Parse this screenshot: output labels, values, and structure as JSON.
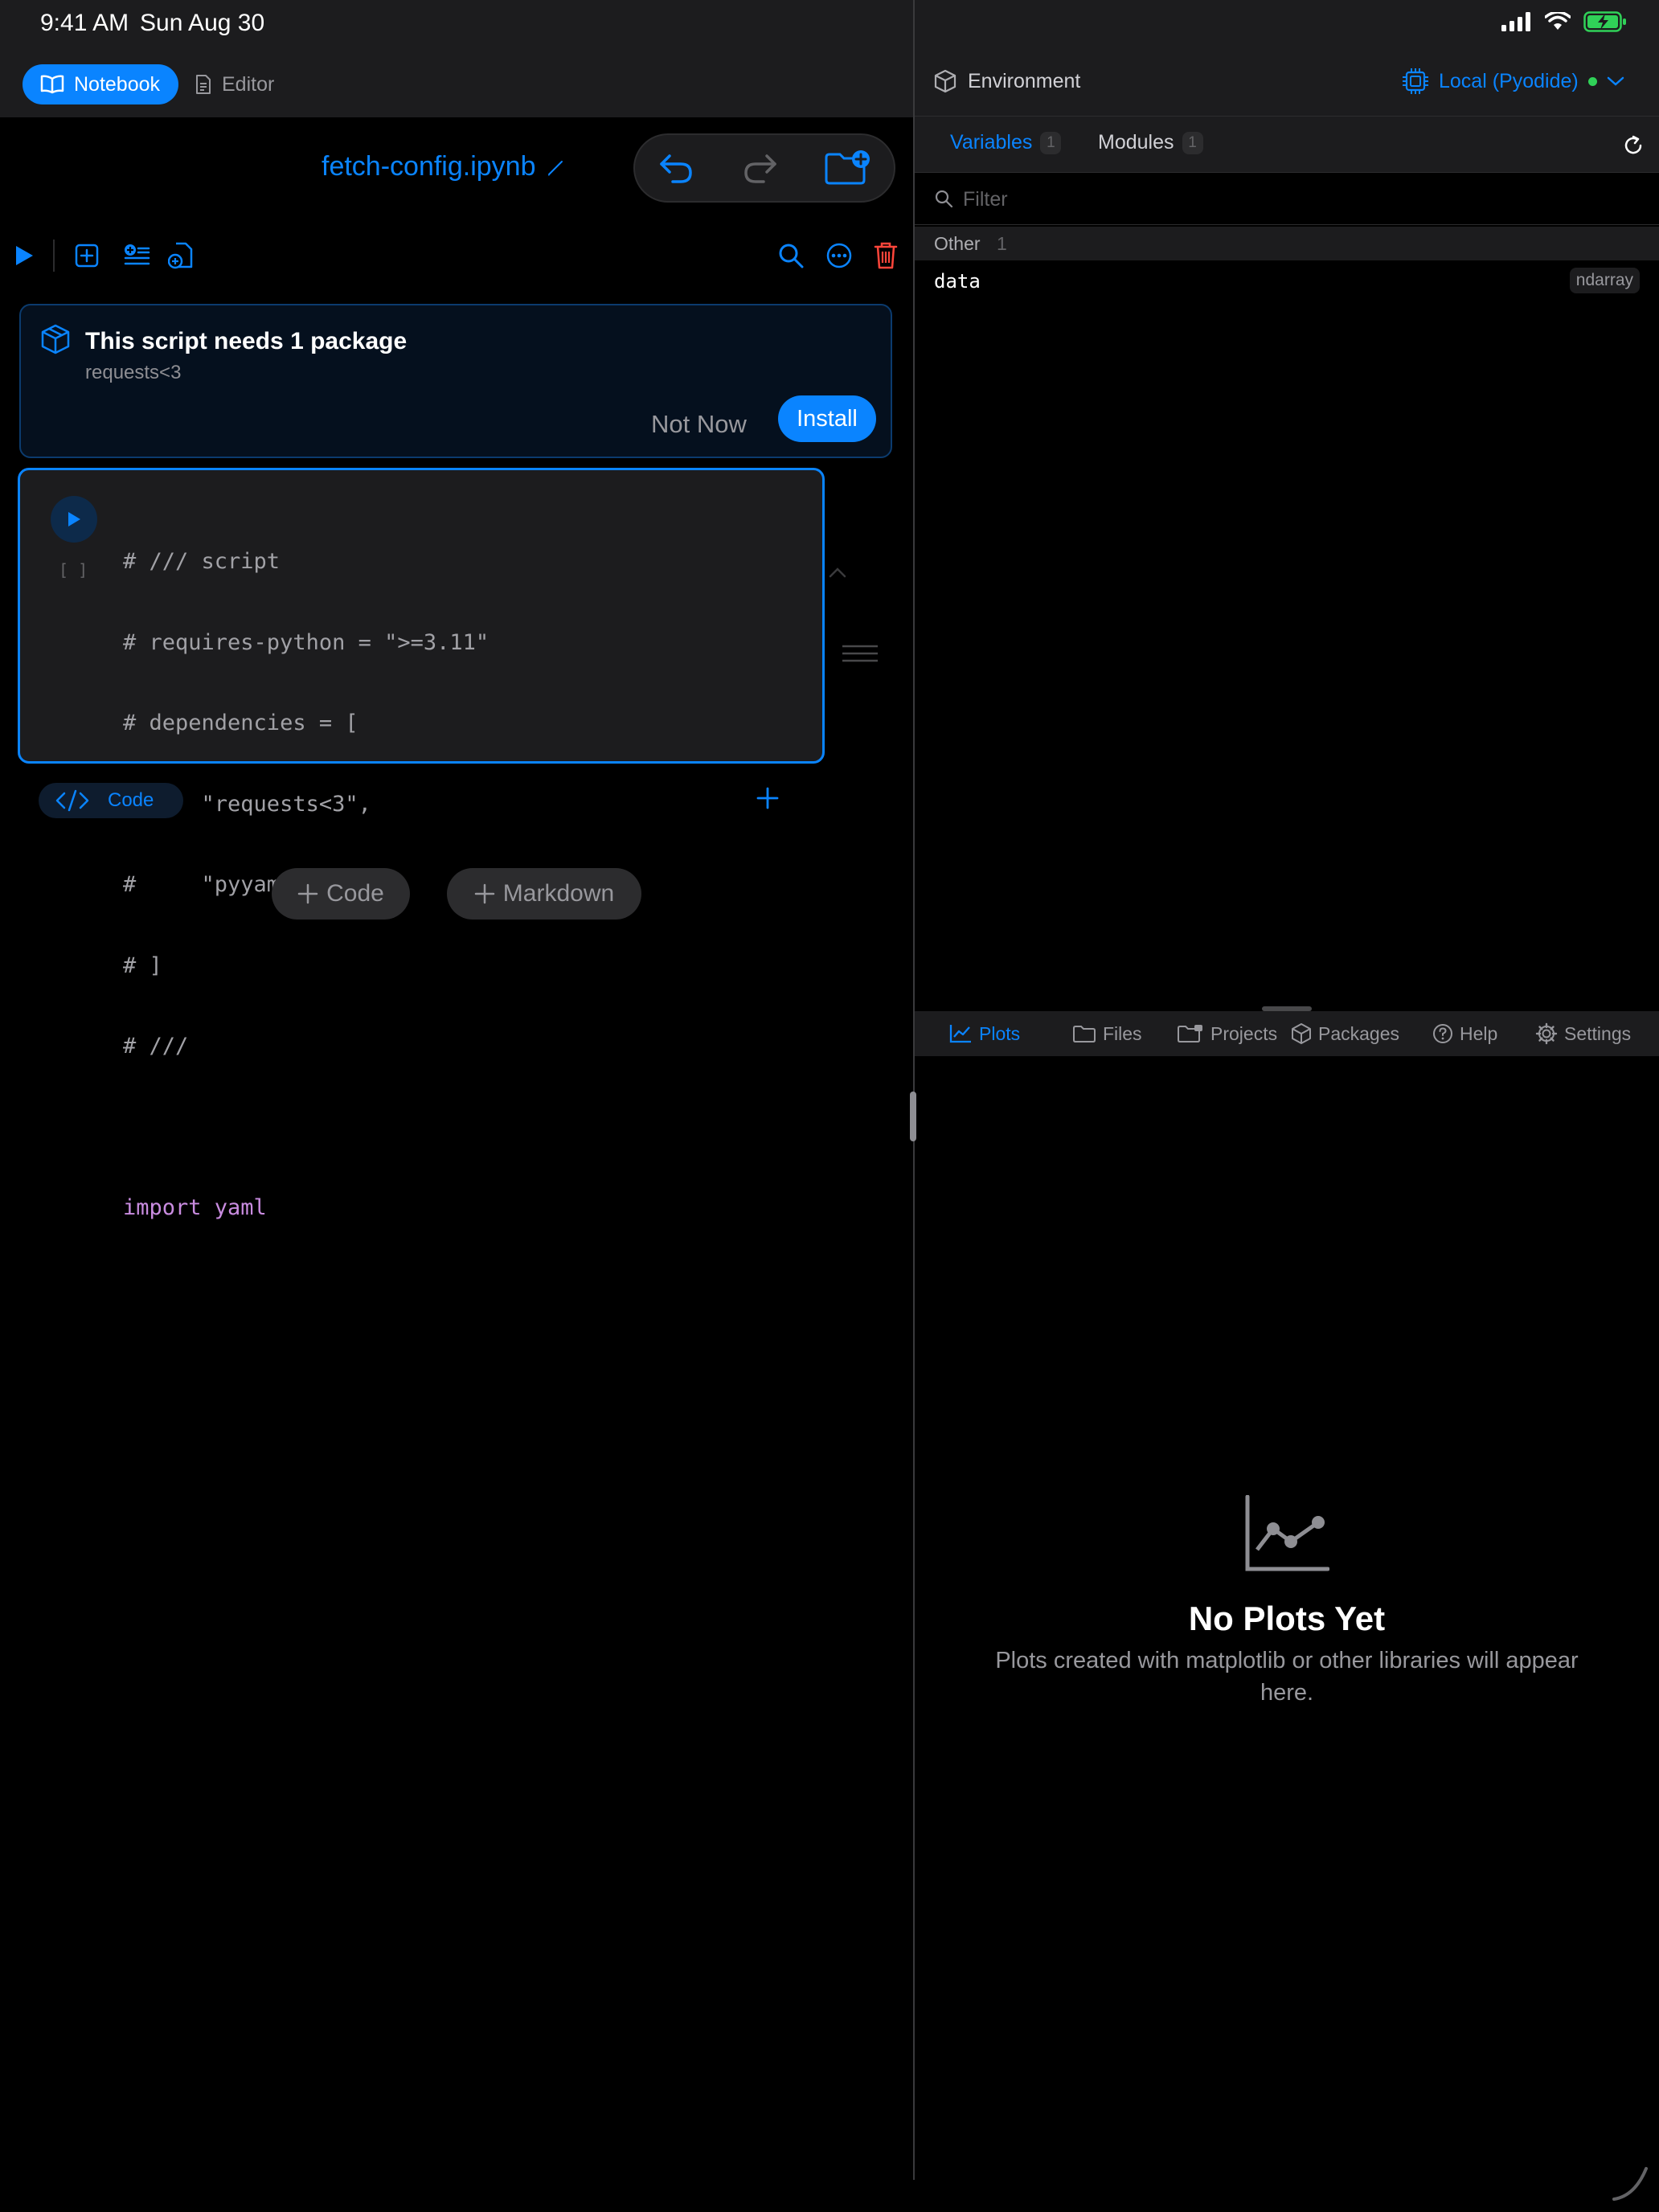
{
  "status_bar": {
    "time": "9:41 AM",
    "date": "Sun Aug 30"
  },
  "left": {
    "tabs": {
      "notebook": "Notebook",
      "editor": "Editor"
    },
    "notebook_title": "fetch-config.ipynb",
    "banner": {
      "title": "This script needs 1 package",
      "subtitle": "requests<3",
      "not_now": "Not Now",
      "install": "Install"
    },
    "cell": {
      "execution_count": "[ ]",
      "code": [
        "# /// script",
        "# requires-python = \">=3.11\"",
        "# dependencies = [",
        "#     \"requests<3\",",
        "#     \"pyyaml\",",
        "# ]",
        "# ///",
        "",
        "import yaml"
      ],
      "type_label": "Code"
    },
    "add_buttons": {
      "code": "Code",
      "markdown": "Markdown"
    }
  },
  "right": {
    "env_title": "Environment",
    "runtime": "Local (Pyodide)",
    "tabs": [
      {
        "label": "Variables",
        "count": "1"
      },
      {
        "label": "Modules",
        "count": "1"
      }
    ],
    "filter_placeholder": "Filter",
    "group": {
      "label": "Other",
      "count": "1"
    },
    "variable": {
      "name": "data",
      "type": "ndarray"
    },
    "bottom_tabs": [
      "Plots",
      "Files",
      "Projects",
      "Packages",
      "Help",
      "Settings"
    ],
    "empty": {
      "title": "No Plots Yet",
      "subtitle": "Plots created with matplotlib or other libraries will appear here."
    }
  },
  "colors": {
    "accent": "#0a84ff",
    "danger": "#ff453a",
    "success": "#30d158",
    "background": "#000000",
    "panel": "#1c1c1e"
  }
}
